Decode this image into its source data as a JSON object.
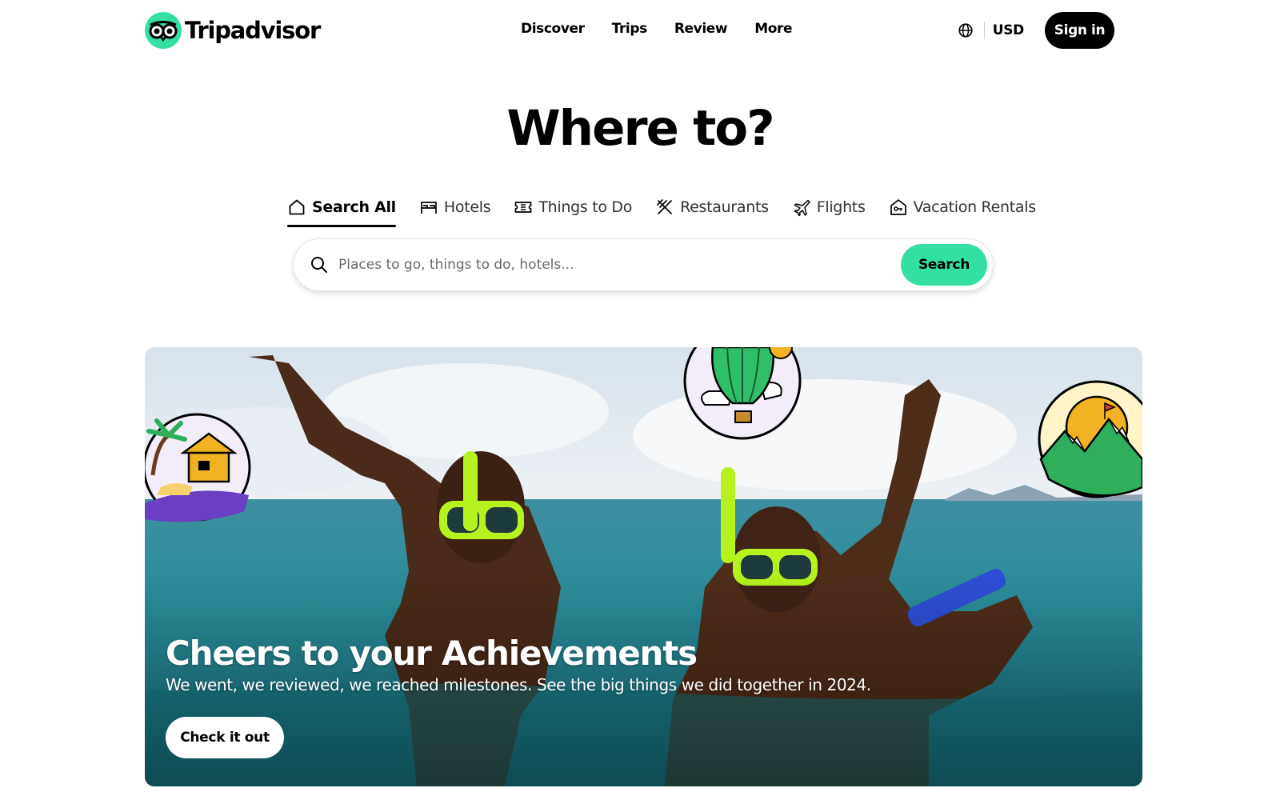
{
  "brand": {
    "name": "Tripadvisor",
    "accent": "#34e0a1"
  },
  "nav": {
    "items": [
      {
        "label": "Discover"
      },
      {
        "label": "Trips"
      },
      {
        "label": "Review"
      },
      {
        "label": "More"
      }
    ]
  },
  "header_tools": {
    "globe_icon": "globe-icon",
    "currency": "USD",
    "signin_label": "Sign in"
  },
  "hero": {
    "title": "Where to?"
  },
  "tabs": [
    {
      "label": "Search All",
      "icon": "home-icon",
      "active": true
    },
    {
      "label": "Hotels",
      "icon": "bed-icon",
      "active": false
    },
    {
      "label": "Things to Do",
      "icon": "ticket-icon",
      "active": false
    },
    {
      "label": "Restaurants",
      "icon": "utensils-icon",
      "active": false
    },
    {
      "label": "Flights",
      "icon": "plane-icon",
      "active": false
    },
    {
      "label": "Vacation Rentals",
      "icon": "house-key-icon",
      "active": false
    }
  ],
  "search": {
    "placeholder": "Places to go, things to do, hotels...",
    "value": "",
    "button_label": "Search"
  },
  "banner": {
    "title": "Cheers to your Achievements",
    "subtitle": "We went, we reviewed, we reached milestones. See the big things we did together in 2024.",
    "button_label": "Check it out",
    "stickers": [
      "beach-hut-sticker",
      "hot-air-balloon-sticker",
      "mountain-sun-sticker"
    ]
  }
}
